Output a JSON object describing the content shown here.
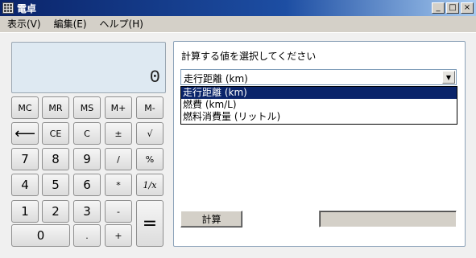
{
  "window": {
    "title": "電卓",
    "controls": [
      "_",
      "□",
      "×"
    ]
  },
  "menu": [
    {
      "label": "表示(V)"
    },
    {
      "label": "編集(E)"
    },
    {
      "label": "ヘルプ(H)"
    }
  ],
  "display": {
    "value": "0"
  },
  "keys": {
    "mc": "MC",
    "mr": "MR",
    "ms": "MS",
    "m_plus": "M+",
    "m_minus": "M-",
    "backspace": "⟵",
    "ce": "CE",
    "c": "C",
    "plus_minus": "±",
    "sqrt": "√",
    "d7": "7",
    "d8": "8",
    "d9": "9",
    "divide": "/",
    "percent": "%",
    "d4": "4",
    "d5": "5",
    "d6": "6",
    "multiply": "*",
    "reciprocal": "1/x",
    "d1": "1",
    "d2": "2",
    "d3": "3",
    "minus": "-",
    "equals": "=",
    "d0": "0",
    "dot": ".",
    "plus": "+"
  },
  "panel": {
    "prompt": "計算する値を選択してください",
    "select": {
      "value": "走行距離 (km)",
      "options": [
        "走行距離 (km)",
        "燃費 (km/L)",
        "燃料消費量 (リットル)"
      ],
      "selected_index": 0
    },
    "calculate_button": "計算",
    "result": ""
  }
}
